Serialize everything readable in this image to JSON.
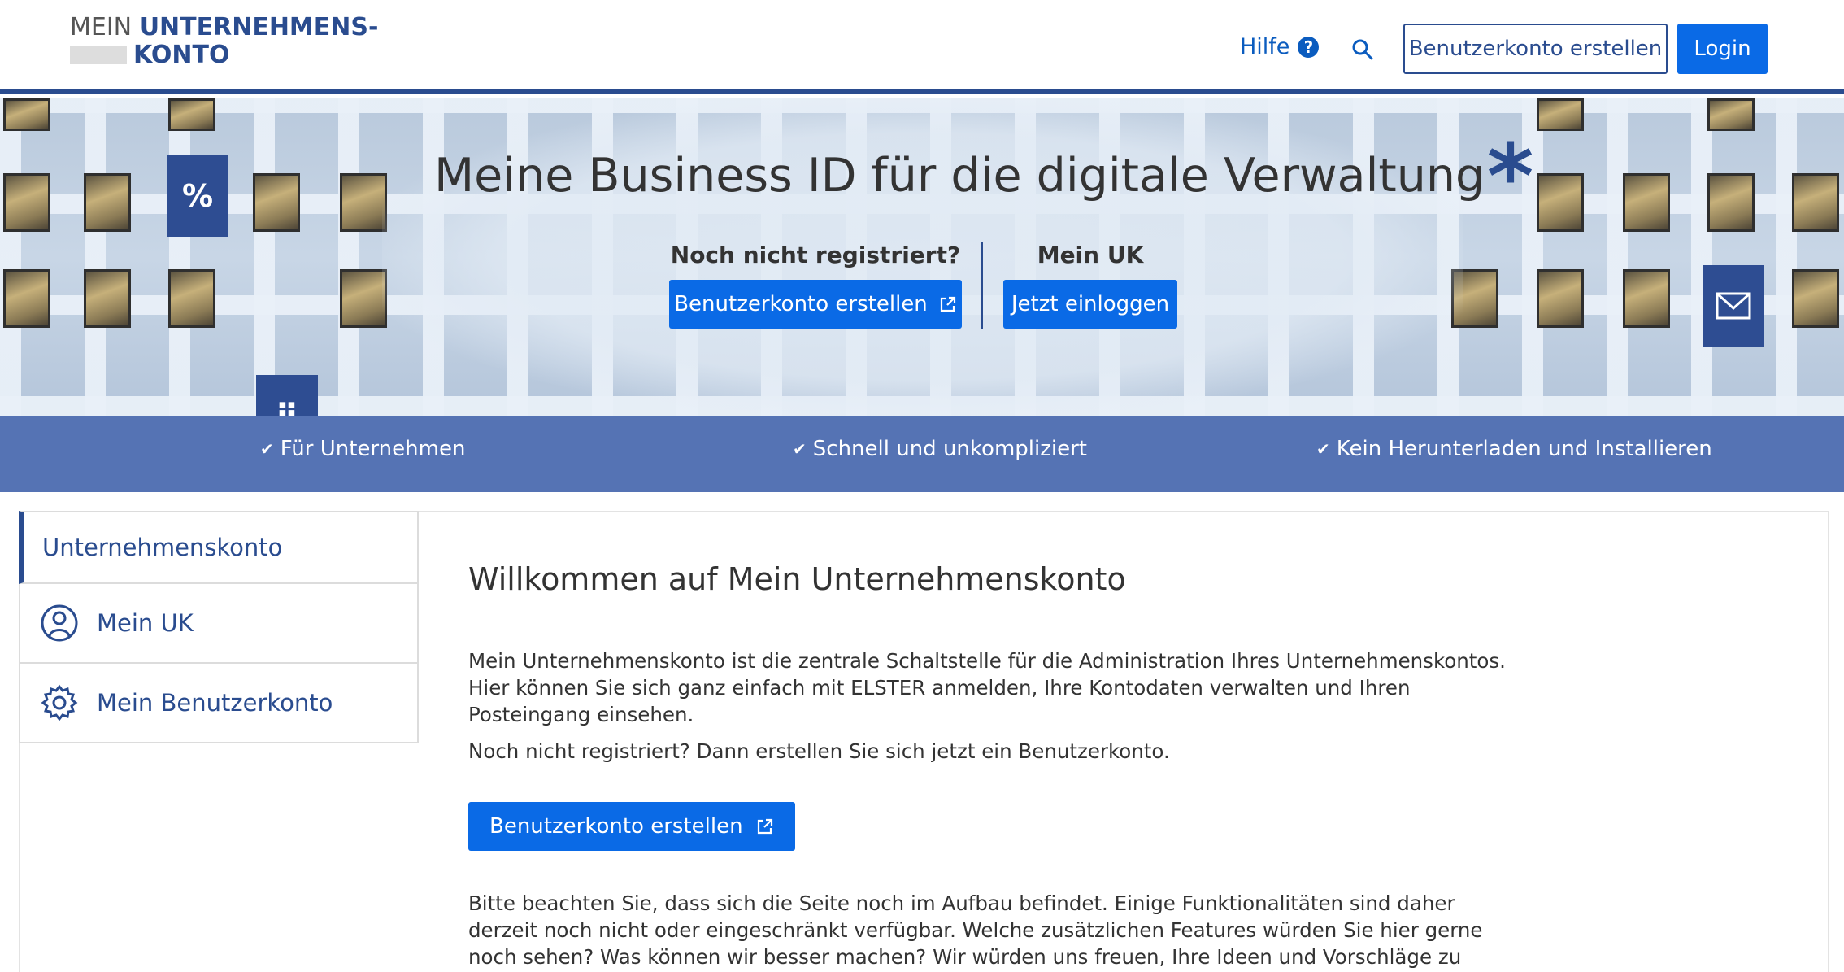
{
  "header": {
    "logo_mein": "MEIN",
    "logo_line1": "UNTERNEHMENS-",
    "logo_line2": "KONTO",
    "help_label": "Hilfe",
    "help_icon": "question-circle-icon",
    "search_icon": "search-icon",
    "register_label": "Benutzerkonto erstellen",
    "login_label": "Login"
  },
  "hero": {
    "title": "Meine Business ID für die digitale Verwaltung",
    "title_mark": "*",
    "register_heading": "Noch nicht registriert?",
    "register_button": "Benutzerkonto erstellen",
    "login_heading": "Mein UK",
    "login_button": "Jetzt einloggen",
    "benefits": [
      "Für Unternehmen",
      "Schnell und unkompliziert",
      "Kein Herunterladen und Installieren"
    ]
  },
  "sidebar": {
    "items": [
      {
        "label": "Unternehmenskonto",
        "icon": ""
      },
      {
        "label": "Mein UK",
        "icon": "user-circle-icon"
      },
      {
        "label": "Mein Benutzerkonto",
        "icon": "gear-icon"
      }
    ]
  },
  "main": {
    "heading": "Willkommen auf Mein Unternehmenskonto",
    "intro": "Mein Unternehmenskonto ist die zentrale Schaltstelle für die Administration Ihres Unternehmenskontos. Hier können Sie sich ganz einfach mit ELSTER anmelden, Ihre Kontodaten verwalten und Ihren Posteingang einsehen.",
    "register_prompt": "Noch nicht registriert? Dann erstellen Sie sich jetzt ein Benutzerkonto.",
    "cta_label": "Benutzerkonto erstellen",
    "note": "Bitte beachten Sie, dass sich die Seite noch im Aufbau befindet. Einige Funktionalitäten sind daher derzeit noch nicht oder eingeschränkt verfügbar. Welche zusätzlichen Features würden Sie hier gerne noch sehen? Was können wir besser machen? Wir würden uns freuen, Ihre Ideen und Vorschläge zu möglichen Ausbaustufen per"
  },
  "colors": {
    "brand_dark": "#2a4c8f",
    "button_blue": "#0a6ae6",
    "benefit_bar": "#3d60aa"
  }
}
